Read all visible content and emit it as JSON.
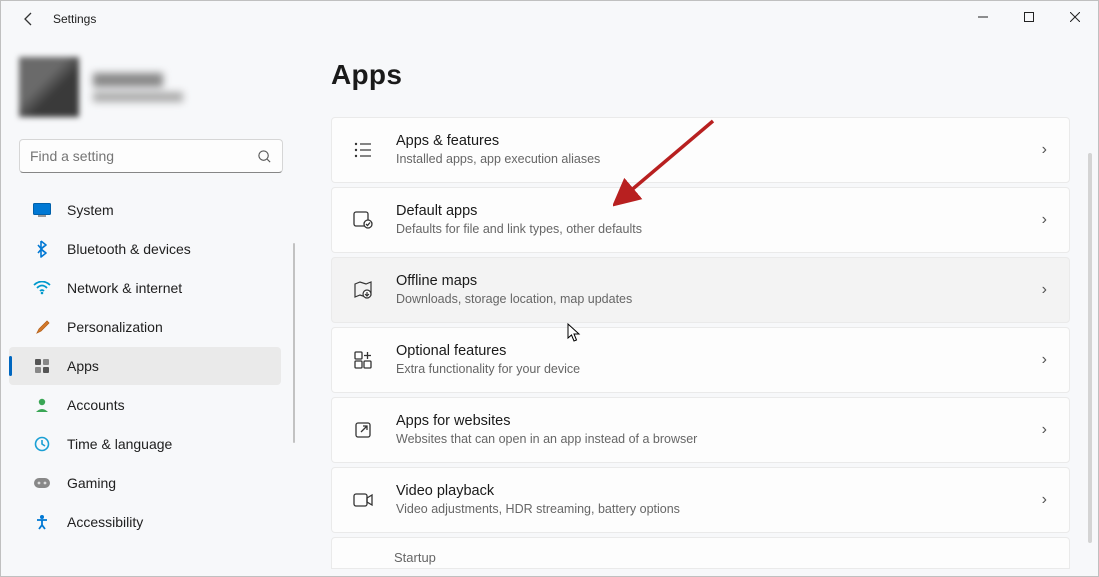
{
  "titlebar": {
    "title": "Settings"
  },
  "search": {
    "placeholder": "Find a setting"
  },
  "sidebar": {
    "items": [
      {
        "label": "System"
      },
      {
        "label": "Bluetooth & devices"
      },
      {
        "label": "Network & internet"
      },
      {
        "label": "Personalization"
      },
      {
        "label": "Apps"
      },
      {
        "label": "Accounts"
      },
      {
        "label": "Time & language"
      },
      {
        "label": "Gaming"
      },
      {
        "label": "Accessibility"
      }
    ]
  },
  "page": {
    "title": "Apps",
    "cards": [
      {
        "title": "Apps & features",
        "sub": "Installed apps, app execution aliases"
      },
      {
        "title": "Default apps",
        "sub": "Defaults for file and link types, other defaults"
      },
      {
        "title": "Offline maps",
        "sub": "Downloads, storage location, map updates"
      },
      {
        "title": "Optional features",
        "sub": "Extra functionality for your device"
      },
      {
        "title": "Apps for websites",
        "sub": "Websites that can open in an app instead of a browser"
      },
      {
        "title": "Video playback",
        "sub": "Video adjustments, HDR streaming, battery options"
      }
    ],
    "partial": "Startup"
  }
}
